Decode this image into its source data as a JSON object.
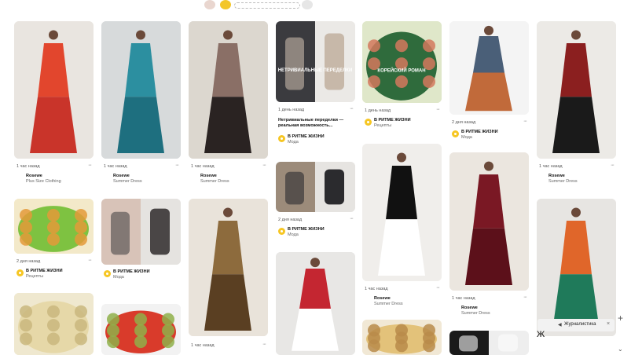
{
  "pins": [
    {
      "time": "1 час назад",
      "publisher": "Rosewe",
      "category": "Plus Size Clothing",
      "avatar": "rosewe",
      "image": "red floral embroidered tunic top",
      "colors": [
        "#e9e5e0",
        "#e2462d",
        "#c9342a"
      ]
    },
    {
      "time": "1 час назад",
      "publisher": "Rosewe",
      "category": "Summer Dress",
      "avatar": "rosewe",
      "image": "teal cape maxi dress",
      "colors": [
        "#d7dadb",
        "#2c8fa0",
        "#1e6f7f"
      ]
    },
    {
      "time": "1 час назад",
      "publisher": "Rosewe",
      "category": "Summer Dress",
      "avatar": "rosewe",
      "image": "floral maxi skirt with black top",
      "colors": [
        "#dcd7cf",
        "#8a6f66",
        "#2a2322"
      ]
    },
    {
      "time": "1 день назад",
      "publisher": "В РИТМЕ ЖИЗНИ",
      "category": "Мода",
      "avatar": "ritm",
      "title": "Нетривиальные переделки — реальная возможность...",
      "image": "collage: clothes remake",
      "overlay": "НЕТРИВИАЛЬНЫЕ ПЕРЕДЕЛКИ",
      "colors": [
        "#ebe9e6",
        "#3b3b3f",
        "#c7b8a9"
      ]
    },
    {
      "time": "1 день назад",
      "publisher": "В РИТМЕ ЖИЗНИ",
      "category": "Рецепты",
      "avatar": "ritm",
      "image": "salad with green sign",
      "overlay": "КОРЕЙСКИЙ РОМАН",
      "colors": [
        "#dfe7c9",
        "#2f6b3c",
        "#d4785d"
      ]
    },
    {
      "time": "2 дня назад",
      "publisher": "В РИТМЕ ЖИЗНИ",
      "category": "Мода",
      "avatar": "ritm",
      "image": "two women casual outfits",
      "colors": [
        "#f4f4f4",
        "#4a5f78",
        "#c16a3a"
      ]
    },
    {
      "time": "1 час назад",
      "publisher": "Rosewe",
      "category": "Summer Dress",
      "avatar": "rosewe",
      "image": "black lace floral maxi dress",
      "colors": [
        "#eceae6",
        "#8b1f1f",
        "#1a1a1a"
      ]
    },
    {
      "time": "2 дня назад",
      "publisher": "В РИТМЕ ЖИЗНИ",
      "category": "Рецепты",
      "avatar": "ritm",
      "image": "baked potatoes in green dish",
      "colors": [
        "#f3e9c9",
        "#7ec241",
        "#e39a3a"
      ]
    },
    {
      "time": "",
      "publisher": "В РИТМЕ ЖИЗНИ",
      "category": "Мода",
      "avatar": "ritm",
      "image": "collage: street fashion",
      "colors": [
        "#e5e3e0",
        "#d8c3b8",
        "#4a4646"
      ]
    },
    {
      "time": "",
      "publisher": "",
      "category": "",
      "avatar": "",
      "image": "sequin off-shoulder gown",
      "colors": [
        "#e9e3da",
        "#8d6b3d",
        "#5a3f22"
      ]
    },
    {
      "time": "2 дня назад",
      "publisher": "В РИТМЕ ЖИЗНИ",
      "category": "Мода",
      "avatar": "ritm",
      "image": "collage: coats and bags",
      "colors": [
        "#e6e4e1",
        "#9c8b7a",
        "#2b2b2e"
      ]
    },
    {
      "time": "1 час назад",
      "publisher": "Rosewe",
      "category": "Summer Dress",
      "avatar": "rosewe",
      "image": "polka dot midi dress",
      "colors": [
        "#f0eeeb",
        "#111111",
        "#ffffff"
      ]
    },
    {
      "time": "1 час назад",
      "publisher": "Rosewe",
      "category": "Summer Dress",
      "avatar": "rosewe",
      "image": "burgundy lace maxi dress",
      "colors": [
        "#ebe6df",
        "#7a1824",
        "#5c101a"
      ]
    },
    {
      "time": "",
      "publisher": "",
      "category": "",
      "avatar": "",
      "image": "colorful striped maxi dress",
      "colors": [
        "#e7e5e2",
        "#e0662a",
        "#1f7a5a"
      ]
    },
    {
      "time": "",
      "publisher": "",
      "category": "",
      "avatar": "",
      "image": "dumplings on plate",
      "colors": [
        "#efe8cf",
        "#e6d8a8",
        "#c9b77e"
      ]
    },
    {
      "time": "",
      "publisher": "",
      "category": "",
      "avatar": "",
      "image": "pickled tomatoes jars",
      "colors": [
        "#f2f2f2",
        "#d93b2b",
        "#8fb04a"
      ]
    },
    {
      "time": "1 час назад",
      "publisher": "Rosewe",
      "category": "",
      "avatar": "rosewe",
      "image": "",
      "colors": []
    },
    {
      "time": "",
      "publisher": "",
      "category": "",
      "avatar": "",
      "image": "red white striped halter dress",
      "colors": [
        "#e8e7e5",
        "#c42631",
        "#ffffff"
      ]
    },
    {
      "time": "",
      "publisher": "",
      "category": "",
      "avatar": "",
      "image": "pastry dough",
      "colors": [
        "#f1e8d5",
        "#e3c27a",
        "#b98b4a"
      ]
    },
    {
      "time": "",
      "publisher": "",
      "category": "",
      "avatar": "",
      "image": "collage: black white dresses",
      "colors": [
        "#eeeeee",
        "#1a1a1a",
        "#f7f7f7"
      ]
    }
  ],
  "notification": {
    "label": "Журналистика",
    "icon": "volume-icon"
  },
  "brand_letter": "Ж",
  "more_label": "···",
  "plus_label": "+",
  "scroll_label": "⌄"
}
